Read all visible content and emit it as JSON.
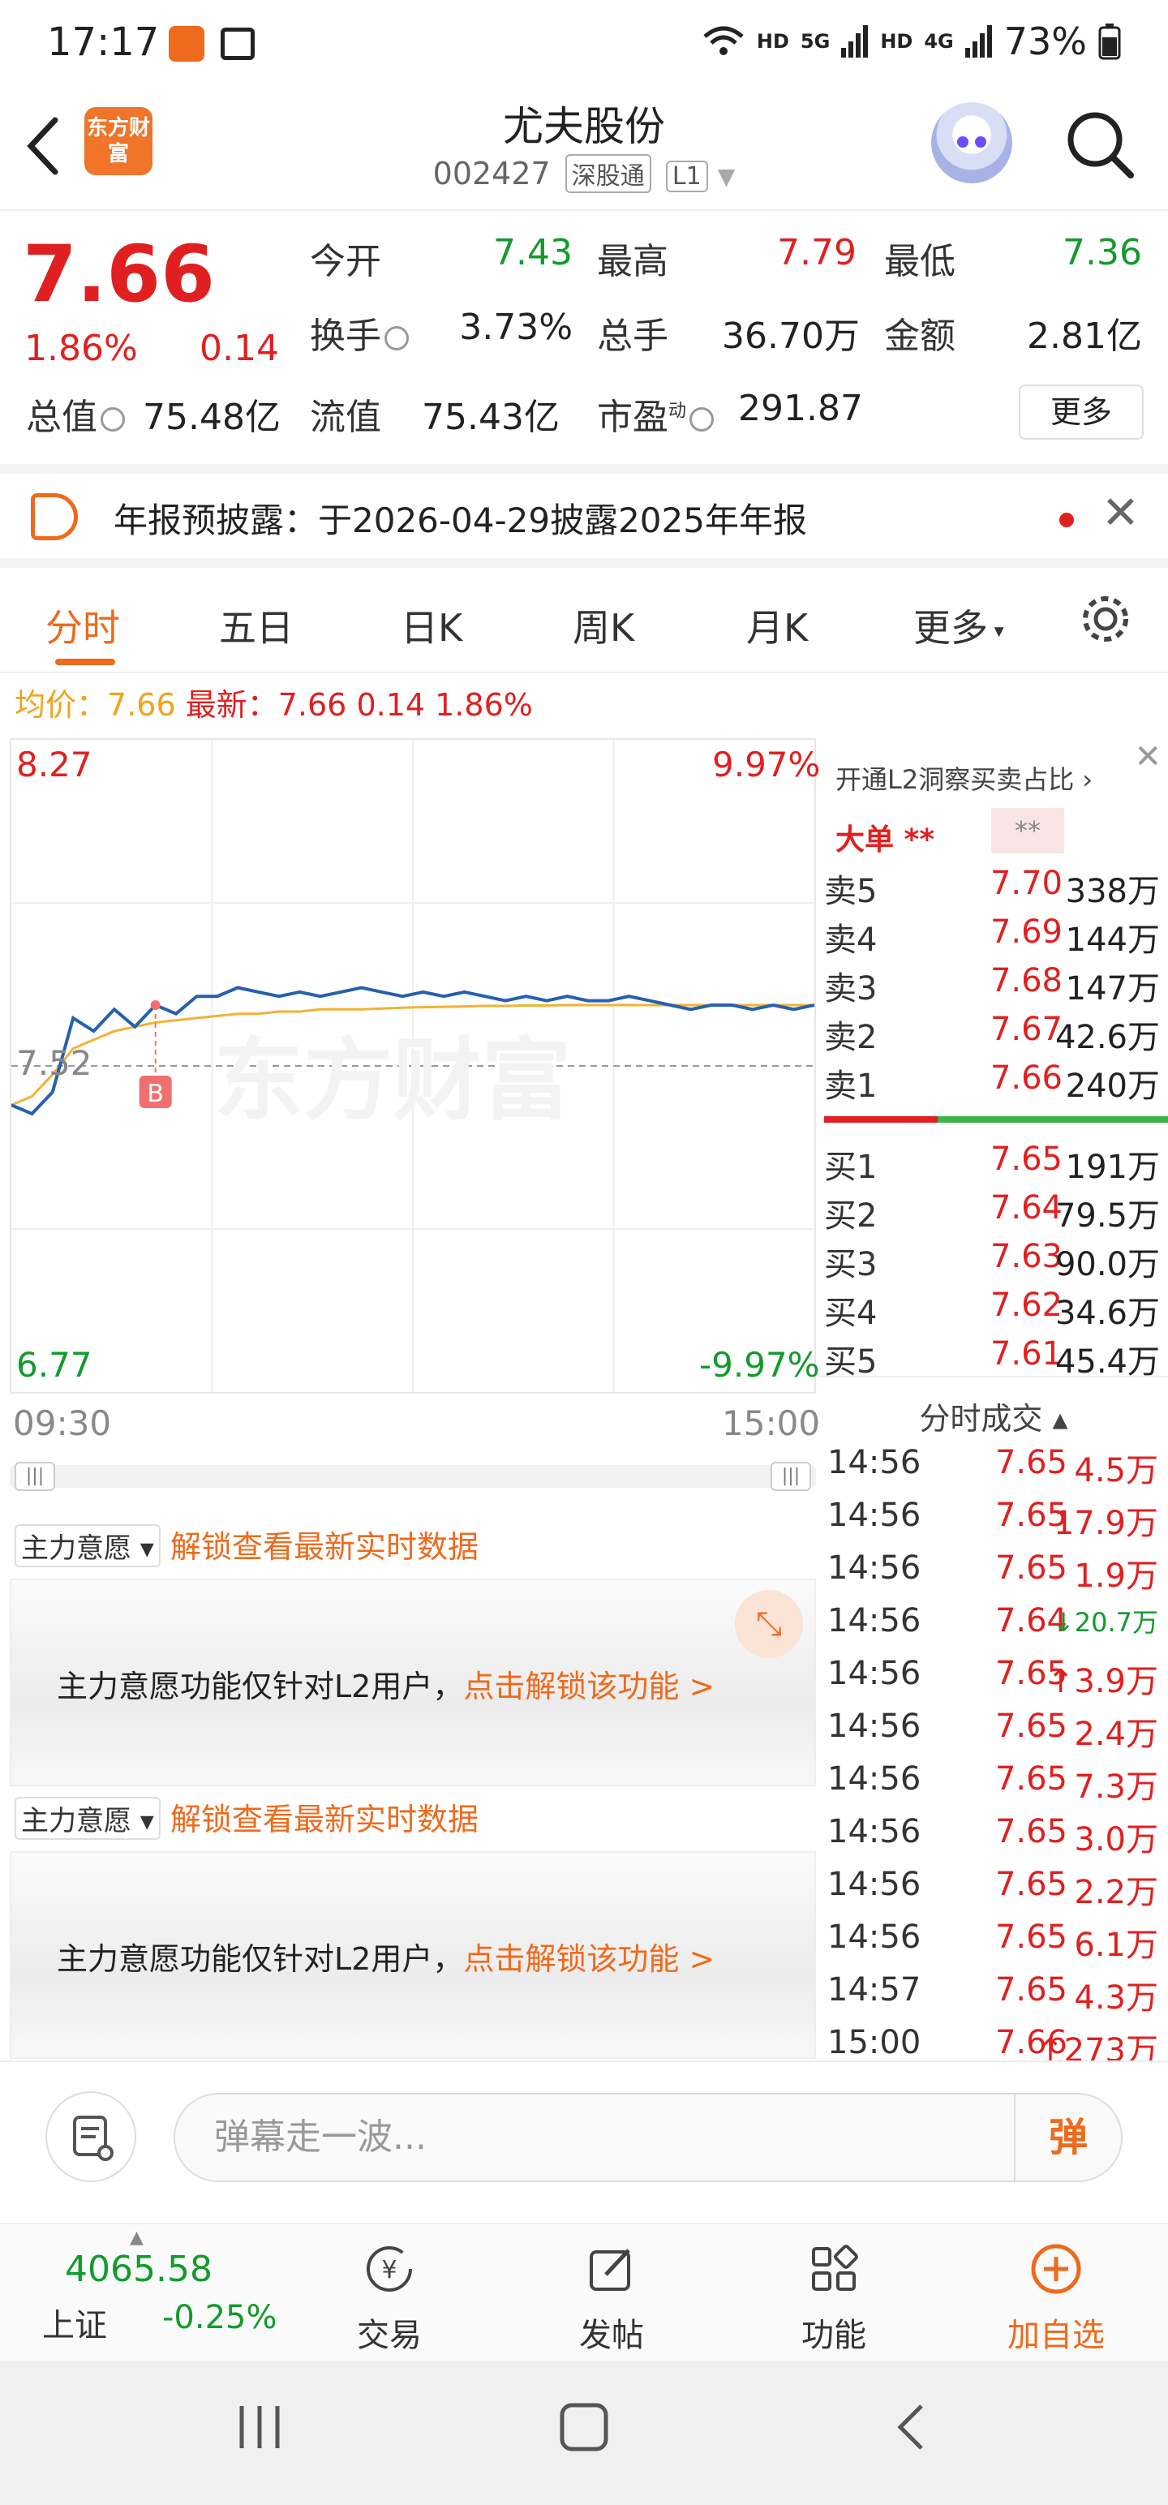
{
  "status_bar": {
    "time": "17:17",
    "hd1": "HD",
    "net1": "5G",
    "hd2": "HD",
    "net2": "4G",
    "battery": "73%"
  },
  "header": {
    "logo_text": "东方财富",
    "stock_name": "尤夫股份",
    "stock_code": "002427",
    "tag_connect": "深股通",
    "tag_level": "L1"
  },
  "quote": {
    "last_price": "7.66",
    "change_pct": "1.86%",
    "change_val": "0.14",
    "open_label": "今开",
    "open": "7.43",
    "high_label": "最高",
    "high": "7.79",
    "low_label": "最低",
    "low": "7.36",
    "turnover_label": "换手",
    "turnover": "3.73%",
    "volume_label": "总手",
    "volume": "36.70万",
    "amount_label": "金额",
    "amount": "2.81亿",
    "mktcap_label": "总值",
    "mktcap": "75.48亿",
    "float_label": "流值",
    "float_cap": "75.43亿",
    "pe_label": "市盈",
    "pe_sup": "动",
    "pe": "291.87",
    "more_label": "更多"
  },
  "notice": {
    "text": "年报预披露：于2026-04-29披露2025年年报",
    "close": "✕"
  },
  "tabs": [
    "分时",
    "五日",
    "日K",
    "周K",
    "月K",
    "更多"
  ],
  "avg_line": {
    "avg_label": "均价：",
    "avg": "7.66",
    "latest_label": "最新：",
    "latest": "7.66",
    "chg": "0.14",
    "pct": "1.86%"
  },
  "chart": {
    "y_top": "8.27",
    "y_mid": "7.52",
    "y_bot": "6.77",
    "pct_top": "9.97%",
    "pct_bot": "-9.97%",
    "t_start": "09:30",
    "t_end": "15:00",
    "watermark": "东方财富",
    "buy_marker": "B",
    "handle": "|||"
  },
  "chart_data": {
    "type": "line",
    "title": "",
    "xlabel": "",
    "ylabel": "",
    "ylim": [
      6.77,
      8.27
    ],
    "prev_close": 7.52,
    "x_range": [
      "09:30",
      "15:00"
    ],
    "series": [
      {
        "name": "",
        "color": "#2660b0",
        "values": [
          7.43,
          7.41,
          7.46,
          7.63,
          7.6,
          7.65,
          7.61,
          7.66,
          7.64,
          7.68,
          7.68,
          7.7,
          7.69,
          7.68,
          7.69,
          7.68,
          7.69,
          7.7,
          7.69,
          7.68,
          7.69,
          7.68,
          7.69,
          7.68,
          7.67,
          7.68,
          7.67,
          7.68,
          7.67,
          7.67,
          7.68,
          7.67,
          7.66,
          7.65,
          7.66,
          7.66,
          7.65,
          7.66,
          7.65,
          7.66
        ]
      },
      {
        "name": "",
        "color": "#f2b233",
        "values": [
          7.43,
          7.45,
          7.5,
          7.56,
          7.58,
          7.6,
          7.61,
          7.62,
          7.625,
          7.63,
          7.635,
          7.64,
          7.64,
          7.645,
          7.645,
          7.65,
          7.65,
          7.65,
          7.652,
          7.654,
          7.655,
          7.656,
          7.657,
          7.658,
          7.658,
          7.659,
          7.659,
          7.66,
          7.66,
          7.66,
          7.66,
          7.66,
          7.66,
          7.66,
          7.66,
          7.66,
          7.66,
          7.66,
          7.66,
          7.66
        ]
      }
    ]
  },
  "order_book": {
    "l2_text": "开通L2洞察买卖占比 ›",
    "big_order_label": "大单 **",
    "big_order_masked": "**",
    "asks": [
      {
        "label": "卖5",
        "price": "7.70",
        "vol": "338万"
      },
      {
        "label": "卖4",
        "price": "7.69",
        "vol": "144万"
      },
      {
        "label": "卖3",
        "price": "7.68",
        "vol": "147万"
      },
      {
        "label": "卖2",
        "price": "7.67",
        "vol": "42.6万"
      },
      {
        "label": "卖1",
        "price": "7.66",
        "vol": "240万"
      }
    ],
    "bids": [
      {
        "label": "买1",
        "price": "7.65",
        "vol": "191万"
      },
      {
        "label": "买2",
        "price": "7.64",
        "vol": "79.5万"
      },
      {
        "label": "买3",
        "price": "7.63",
        "vol": "90.0万"
      },
      {
        "label": "买4",
        "price": "7.62",
        "vol": "34.6万"
      },
      {
        "label": "买5",
        "price": "7.61",
        "vol": "45.4万"
      }
    ]
  },
  "ticks": {
    "title": "分时成交 ▴",
    "rows": [
      {
        "time": "14:56",
        "price": "7.65",
        "vol": "4.5万",
        "dir": ""
      },
      {
        "time": "14:56",
        "price": "7.65",
        "vol": "17.9万",
        "dir": ""
      },
      {
        "time": "14:56",
        "price": "7.65",
        "vol": "1.9万",
        "dir": ""
      },
      {
        "time": "14:56",
        "price": "7.64",
        "vol": "↓20.7万",
        "dir": "down"
      },
      {
        "time": "14:56",
        "price": "7.65",
        "vol": "↑3.9万",
        "dir": "up"
      },
      {
        "time": "14:56",
        "price": "7.65",
        "vol": "2.4万",
        "dir": ""
      },
      {
        "time": "14:56",
        "price": "7.65",
        "vol": "7.3万",
        "dir": ""
      },
      {
        "time": "14:56",
        "price": "7.65",
        "vol": "3.0万",
        "dir": ""
      },
      {
        "time": "14:56",
        "price": "7.65",
        "vol": "2.2万",
        "dir": ""
      },
      {
        "time": "14:56",
        "price": "7.65",
        "vol": "6.1万",
        "dir": ""
      },
      {
        "time": "14:57",
        "price": "7.65",
        "vol": "4.3万",
        "dir": ""
      },
      {
        "time": "15:00",
        "price": "7.66",
        "vol": "↑273万",
        "dir": "up"
      }
    ]
  },
  "main_force": {
    "select_label": "主力意愿 ▾",
    "unlock_text": "解锁查看最新实时数据",
    "panel_text": "主力意愿功能仅针对L2用户，",
    "panel_link": "点击解锁该功能 >",
    "expand": "⤡"
  },
  "comment": {
    "placeholder": "弹幕走一波...",
    "danmu_btn": "弹"
  },
  "bottom_nav": {
    "index_value": "4065.58",
    "index_name": "上证",
    "index_change": "-0.25%",
    "items": [
      "交易",
      "发帖",
      "功能",
      "加自选"
    ]
  }
}
